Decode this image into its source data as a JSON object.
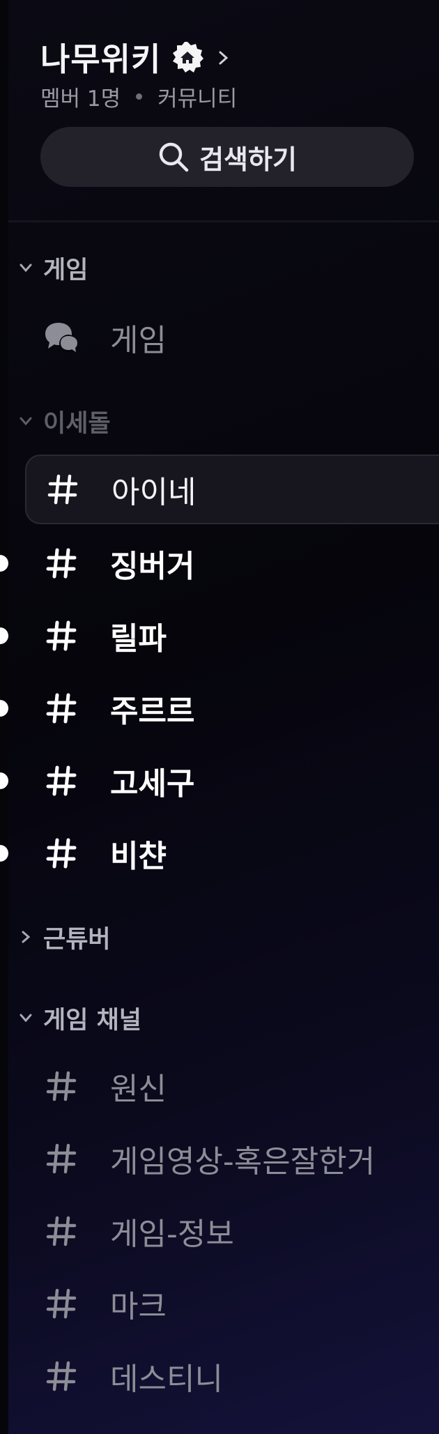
{
  "server": {
    "name": "나무위키",
    "members": "멤버 1명",
    "type": "커뮤니티"
  },
  "search": {
    "label": "검색하기"
  },
  "categories": [
    {
      "label": "게임",
      "expanded": true
    },
    {
      "label": "이세돌",
      "expanded": true
    },
    {
      "label": "근튜버",
      "expanded": false
    },
    {
      "label": "게임 채널",
      "expanded": true
    }
  ],
  "channels": {
    "game_forum": "게임",
    "isedol": [
      "아이네",
      "징버거",
      "릴파",
      "주르르",
      "고세구",
      "비챤"
    ],
    "game_channels": [
      "원신",
      "게임영상-혹은잘한거",
      "게임-정보",
      "마크",
      "데스티니"
    ]
  },
  "colors": {
    "accent_unread": "#ffffff",
    "muted_text": "#8d8d97",
    "search_bg": "#23222b"
  }
}
